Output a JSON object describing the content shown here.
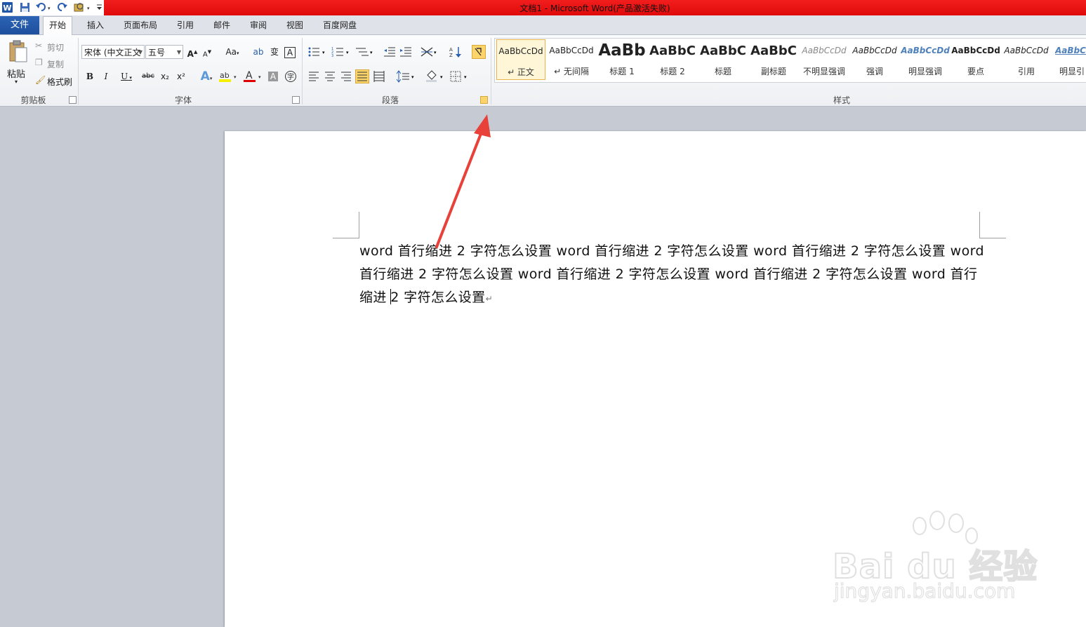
{
  "window": {
    "title": "文档1 - Microsoft Word(产品激活失败)"
  },
  "tabs": [
    {
      "label": "文件"
    },
    {
      "label": "开始"
    },
    {
      "label": "插入"
    },
    {
      "label": "页面布局"
    },
    {
      "label": "引用"
    },
    {
      "label": "邮件"
    },
    {
      "label": "审阅"
    },
    {
      "label": "视图"
    },
    {
      "label": "百度网盘"
    }
  ],
  "clipboard": {
    "paste_label": "粘贴",
    "cut_label": "剪切",
    "copy_label": "复制",
    "format_painter_label": "格式刷",
    "group_label": "剪贴板"
  },
  "font": {
    "font_name": "宋体 (中文正文",
    "font_size": "五号",
    "group_label": "字体",
    "grow": "A",
    "shrink": "A",
    "case": "Aa",
    "bold": "B",
    "italic": "I",
    "underline": "U",
    "strike": "abc",
    "subscript": "x₂",
    "superscript": "x²",
    "color_a": "A",
    "char_border": "A",
    "enclose": "字"
  },
  "paragraph": {
    "group_label": "段落"
  },
  "styles": {
    "group_label": "样式",
    "items": [
      {
        "preview": "AaBbCcDd",
        "name": "↵ 正文"
      },
      {
        "preview": "AaBbCcDd",
        "name": "↵ 无间隔"
      },
      {
        "preview": "AaBb",
        "name": "标题 1"
      },
      {
        "preview": "AaBbC",
        "name": "标题 2"
      },
      {
        "preview": "AaBbC",
        "name": "标题"
      },
      {
        "preview": "AaBbC",
        "name": "副标题"
      },
      {
        "preview": "AaBbCcDd",
        "name": "不明显强调"
      },
      {
        "preview": "AaBbCcDd",
        "name": "强调"
      },
      {
        "preview": "AaBbCcDd",
        "name": "明显强调"
      },
      {
        "preview": "AaBbCcDd",
        "name": "要点"
      },
      {
        "preview": "AaBbCcDd",
        "name": "引用"
      },
      {
        "preview": "AaBbCc",
        "name": "明显引"
      }
    ]
  },
  "document": {
    "text_before_cursor": "word 首行缩进 2 字符怎么设置 word 首行缩进 2 字符怎么设置 word 首行缩进 2 字符怎么设置 word 首行缩进 2 字符怎么设置 word 首行缩进 2 字符怎么设置 word 首行缩进 2 字符怎么设置 word 首行缩进 ",
    "text_after_cursor": "2 字符怎么设置",
    "paragraph_mark": "↵"
  },
  "watermark": {
    "brand": "Bai du 经验",
    "url": "jingyan.baidu.com"
  },
  "colors": {
    "title_bar": "#e81212",
    "file_tab": "#2a5eaf",
    "annotation_arrow": "#e8413a",
    "selected_style_border": "#e8b34d"
  }
}
